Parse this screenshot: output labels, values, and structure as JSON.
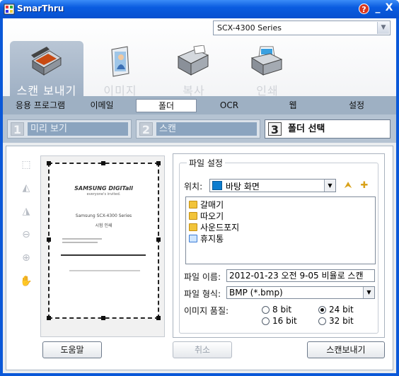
{
  "window": {
    "title": "SmarThru",
    "help_label": "?",
    "minimize_label": "_",
    "close_label": "X"
  },
  "model": {
    "selected": "SCX-4300 Series"
  },
  "tabs": [
    {
      "label": "스캔 보내기",
      "icon": "scanner-icon",
      "active": true
    },
    {
      "label": "이미지",
      "icon": "image-person-icon",
      "active": false
    },
    {
      "label": "복사",
      "icon": "copier-icon",
      "active": false
    },
    {
      "label": "인쇄",
      "icon": "printer-icon",
      "active": false
    }
  ],
  "subnav": [
    {
      "label": "응용 프로그램",
      "active": false
    },
    {
      "label": "이메일",
      "active": false
    },
    {
      "label": "폴더",
      "active": true
    },
    {
      "label": "OCR",
      "active": false
    },
    {
      "label": "웹",
      "active": false
    },
    {
      "label": "설정",
      "active": false
    }
  ],
  "steps": [
    {
      "num": "1",
      "label": "미리 보기",
      "state": "done"
    },
    {
      "num": "2",
      "label": "스캔",
      "state": "done"
    },
    {
      "num": "3",
      "label": "폴더 선택",
      "state": "current"
    }
  ],
  "tools": [
    "select-area-icon",
    "rotate-left-icon",
    "rotate-right-icon",
    "zoom-out-icon",
    "zoom-in-icon",
    "hand-pan-icon"
  ],
  "preview": {
    "brand": "SAMSUNG DIGITall",
    "tagline": "everyone's invited.",
    "heading": "Samsung SCX-4300 Series",
    "subheading": "시험 인쇄"
  },
  "file_settings": {
    "group_title": "파일 설정",
    "location_label": "위치:",
    "location_value": "바탕 화면",
    "folders": [
      {
        "name": "갈매기",
        "icon": "folder-icon"
      },
      {
        "name": "따오기",
        "icon": "folder-icon"
      },
      {
        "name": "사운드포지",
        "icon": "folder-icon"
      },
      {
        "name": "휴지통",
        "icon": "recycle-bin-icon"
      }
    ],
    "filename_label": "파일 이름:",
    "filename_value": "2012-01-23 오전 9-05 비율로 스캔",
    "format_label": "파일 형식:",
    "format_value": "BMP (*.bmp)",
    "quality_label": "이미지 품질:",
    "quality_options": [
      {
        "label": "8 bit",
        "selected": false
      },
      {
        "label": "24 bit",
        "selected": true
      },
      {
        "label": "16 bit",
        "selected": false
      },
      {
        "label": "32 bit",
        "selected": false
      }
    ]
  },
  "buttons": {
    "help": "도움말",
    "cancel": "취소",
    "send": "스캔보내기"
  }
}
